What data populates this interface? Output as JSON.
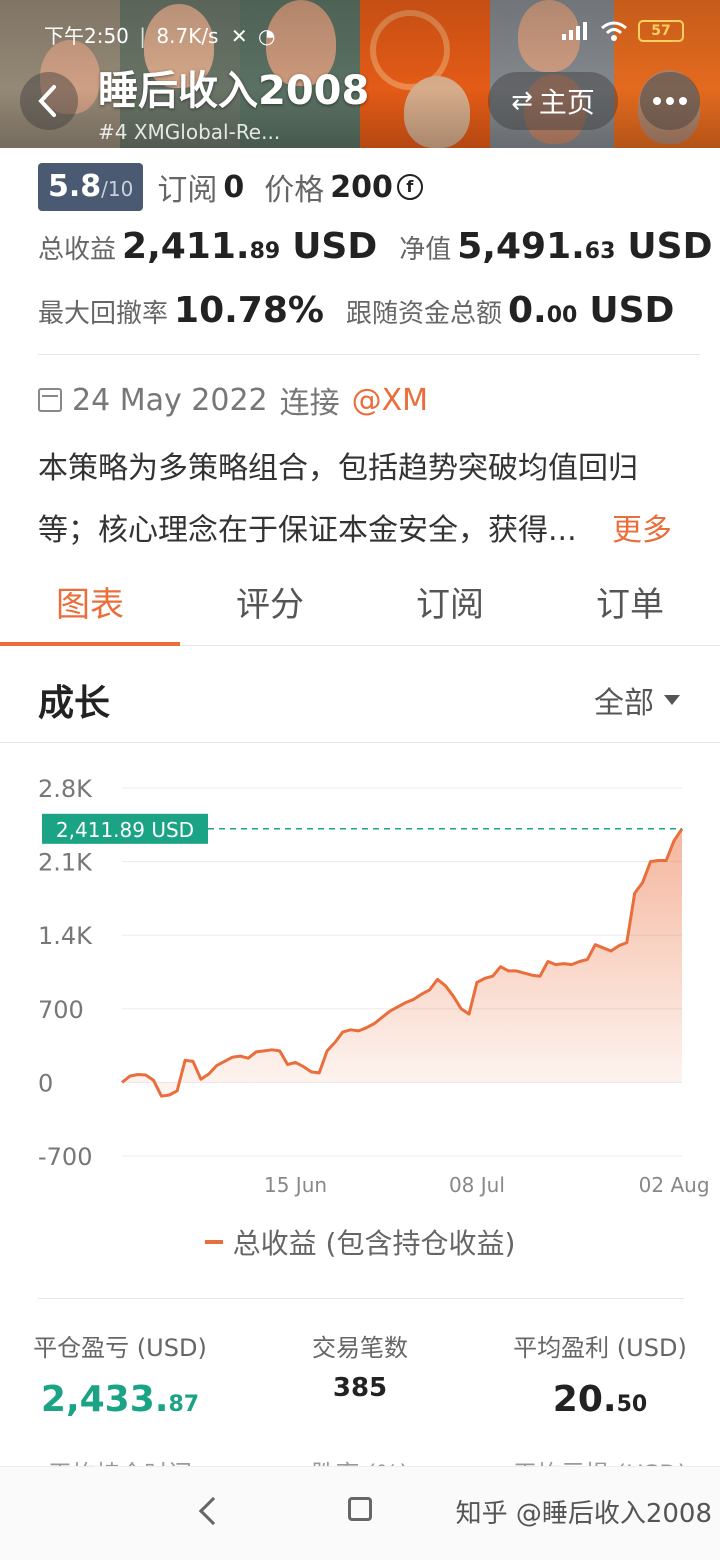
{
  "status_bar": {
    "time": "下午2:50",
    "speed": "8.7K/s",
    "battery": "57"
  },
  "header": {
    "title": "睡后收入2008",
    "subtitle": "#4  XMGlobal-Re...",
    "home_label": "主页"
  },
  "summary": {
    "score": "5.8",
    "score_den": "/10",
    "subscribe_label": "订阅",
    "subscribe_count": "0",
    "price_label": "价格",
    "price_value": "200",
    "total_profit_label": "总收益",
    "total_profit_int": "2,411.",
    "total_profit_dec": "89",
    "total_profit_unit": "USD",
    "equity_label": "净值",
    "equity_int": "5,491.",
    "equity_dec": "63",
    "equity_unit": "USD",
    "drawdown_label": "最大回撤率",
    "drawdown_value": "10.78%",
    "follow_label": "跟随资金总额",
    "follow_int": "0.",
    "follow_dec": "00",
    "follow_unit": "USD",
    "date": "24 May 2022",
    "connect_label": "连接",
    "broker": "@XM",
    "description_line1": "本策略为多策略组合，包括趋势突破均值回归",
    "description_line2": "等；核心理念在于保证本金安全，获得...",
    "more_label": "更多"
  },
  "tabs": [
    {
      "label": "图表",
      "active": true
    },
    {
      "label": "评分",
      "active": false
    },
    {
      "label": "订阅",
      "active": false
    },
    {
      "label": "订单",
      "active": false
    }
  ],
  "growth": {
    "title": "成长",
    "range": "全部"
  },
  "chart_data": {
    "type": "area",
    "y_ticks": [
      "2.8K",
      "2.1K",
      "1.4K",
      "700",
      "0",
      "-700"
    ],
    "y_tick_values": [
      2800,
      2100,
      1400,
      700,
      0,
      -700
    ],
    "ylim": [
      -700,
      2800
    ],
    "x_tick_labels": [
      "15 Jun",
      "08 Jul",
      "02 Aug"
    ],
    "x_tick_days": [
      22,
      45,
      70
    ],
    "x_start": "24 May 2022",
    "x_range_days": [
      0,
      71
    ],
    "current_value_label": "2,411.89 USD",
    "current_value": 2411.89,
    "color": "#ea6e3c",
    "marker_color": "#1aa385",
    "series": [
      {
        "name": "总收益 (包含持仓收益)",
        "points": [
          [
            0,
            0
          ],
          [
            1,
            60
          ],
          [
            2,
            75
          ],
          [
            3,
            70
          ],
          [
            4,
            20
          ],
          [
            5,
            -130
          ],
          [
            6,
            -120
          ],
          [
            7,
            -80
          ],
          [
            8,
            210
          ],
          [
            9,
            200
          ],
          [
            10,
            30
          ],
          [
            11,
            80
          ],
          [
            12,
            160
          ],
          [
            13,
            200
          ],
          [
            14,
            240
          ],
          [
            15,
            250
          ],
          [
            16,
            230
          ],
          [
            17,
            290
          ],
          [
            18,
            300
          ],
          [
            19,
            310
          ],
          [
            20,
            300
          ],
          [
            21,
            170
          ],
          [
            22,
            190
          ],
          [
            23,
            150
          ],
          [
            24,
            100
          ],
          [
            25,
            90
          ],
          [
            26,
            300
          ],
          [
            27,
            380
          ],
          [
            28,
            480
          ],
          [
            29,
            500
          ],
          [
            30,
            490
          ],
          [
            31,
            520
          ],
          [
            32,
            560
          ],
          [
            33,
            620
          ],
          [
            34,
            680
          ],
          [
            35,
            720
          ],
          [
            36,
            760
          ],
          [
            37,
            790
          ],
          [
            38,
            840
          ],
          [
            39,
            880
          ],
          [
            40,
            980
          ],
          [
            41,
            920
          ],
          [
            42,
            820
          ],
          [
            43,
            700
          ],
          [
            44,
            650
          ],
          [
            45,
            950
          ],
          [
            46,
            990
          ],
          [
            47,
            1010
          ],
          [
            48,
            1100
          ],
          [
            49,
            1060
          ],
          [
            50,
            1060
          ],
          [
            51,
            1040
          ],
          [
            52,
            1020
          ],
          [
            53,
            1010
          ],
          [
            54,
            1150
          ],
          [
            55,
            1120
          ],
          [
            56,
            1130
          ],
          [
            57,
            1120
          ],
          [
            58,
            1150
          ],
          [
            59,
            1170
          ],
          [
            60,
            1310
          ],
          [
            61,
            1280
          ],
          [
            62,
            1250
          ],
          [
            63,
            1300
          ],
          [
            64,
            1330
          ],
          [
            65,
            1800
          ],
          [
            66,
            1900
          ],
          [
            67,
            2100
          ],
          [
            68,
            2110
          ],
          [
            69,
            2110
          ],
          [
            70,
            2300
          ],
          [
            71,
            2411.89
          ]
        ]
      }
    ]
  },
  "legend": {
    "label": "总收益 (包含持仓收益)"
  },
  "stats": [
    {
      "label": "平仓盈亏 (USD)",
      "int": "2,433.",
      "dec": "87",
      "green": true
    },
    {
      "label": "交易笔数",
      "int": "385",
      "dec": "",
      "green": false
    },
    {
      "label": "平均盈利 (USD)",
      "int": "20.",
      "dec": "50",
      "green": false
    }
  ],
  "stats_row2": [
    {
      "label": "平均持仓时间"
    },
    {
      "label": "胜率 (%)"
    },
    {
      "label": "平均亏损 (USD)"
    }
  ],
  "watermark": "知乎 @睡后收入2008"
}
